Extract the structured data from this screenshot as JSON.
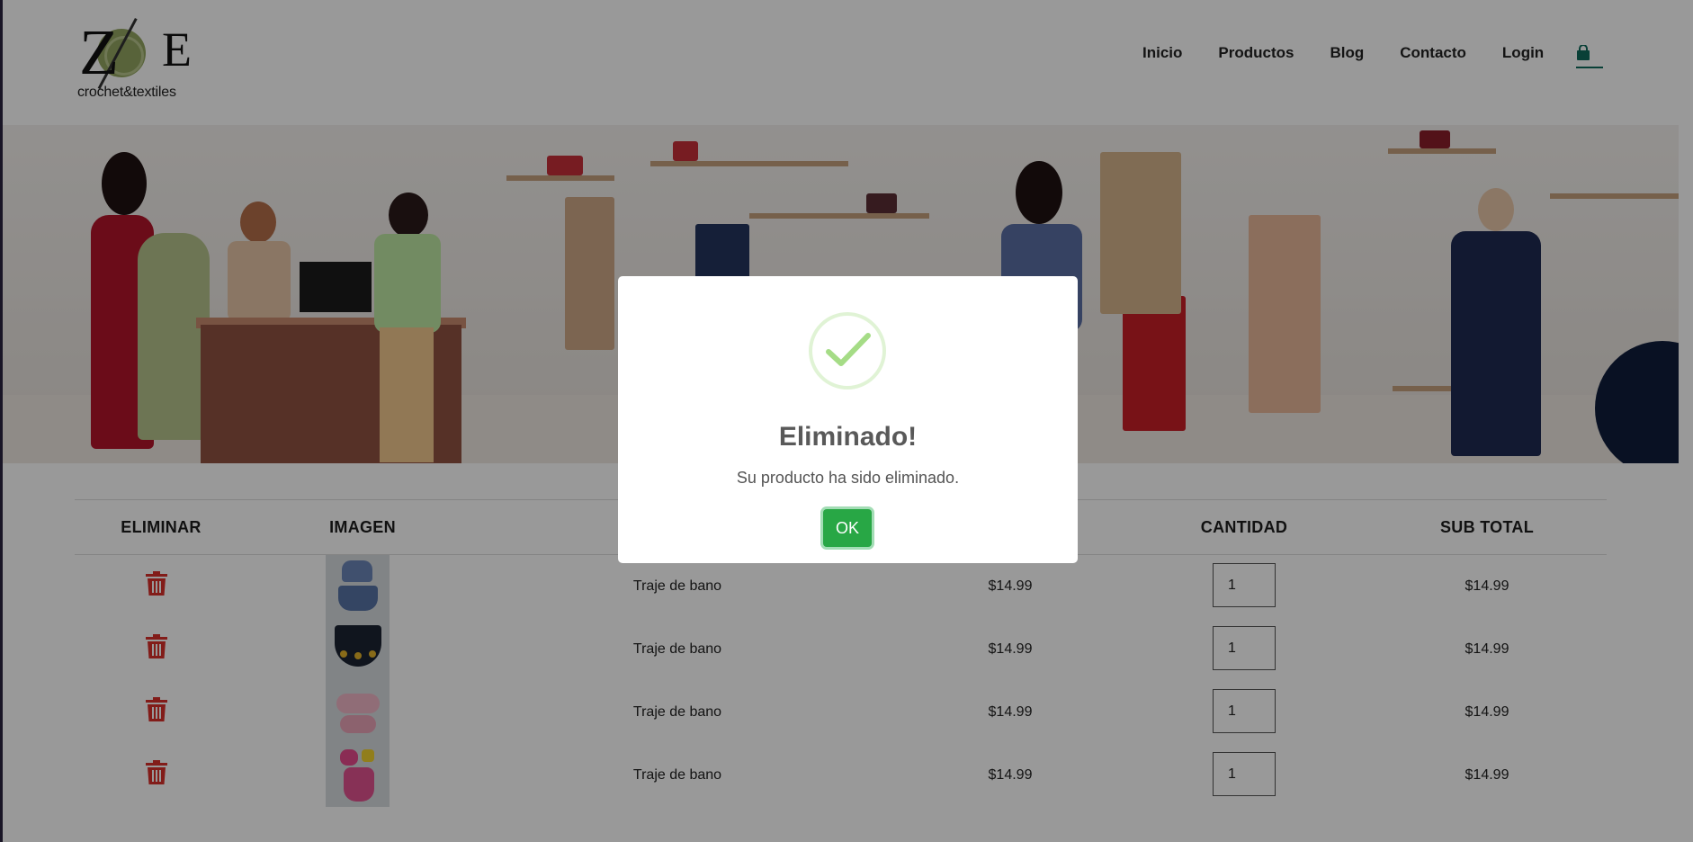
{
  "brand": {
    "logo_mark": "ZoE",
    "tagline": "crochet&textiles",
    "colors": {
      "yarn": "#93a561",
      "accent": "#0f6b5c"
    }
  },
  "nav": {
    "items": [
      "Inicio",
      "Productos",
      "Blog",
      "Contacto",
      "Login"
    ],
    "cart_icon": "shopping-bag-icon"
  },
  "table": {
    "headers": {
      "remove": "ELIMINAR",
      "image": "IMAGEN",
      "quantity": "CANTIDAD",
      "subtotal": "SUB TOTAL"
    },
    "rows": [
      {
        "name": "Traje de bano",
        "price": "$14.99",
        "quantity": "1",
        "subtotal": "$14.99",
        "thumb": "blue denim bikini"
      },
      {
        "name": "Traje de bano",
        "price": "$14.99",
        "quantity": "1",
        "subtotal": "$14.99",
        "thumb": "navy crochet top with sunflowers"
      },
      {
        "name": "Traje de bano",
        "price": "$14.99",
        "quantity": "1",
        "subtotal": "$14.99",
        "thumb": "pink ruffle bikini"
      },
      {
        "name": "Traje de bano",
        "price": "$14.99",
        "quantity": "1",
        "subtotal": "$14.99",
        "thumb": "pink and yellow one-piece"
      }
    ],
    "remove_icon": "trash-icon",
    "remove_color": "#d9302b"
  },
  "modal": {
    "icon": "checkmark-icon",
    "title": "Eliminado!",
    "message": "Su producto ha sido eliminado.",
    "confirm_label": "OK",
    "confirm_color": "#28a745"
  }
}
